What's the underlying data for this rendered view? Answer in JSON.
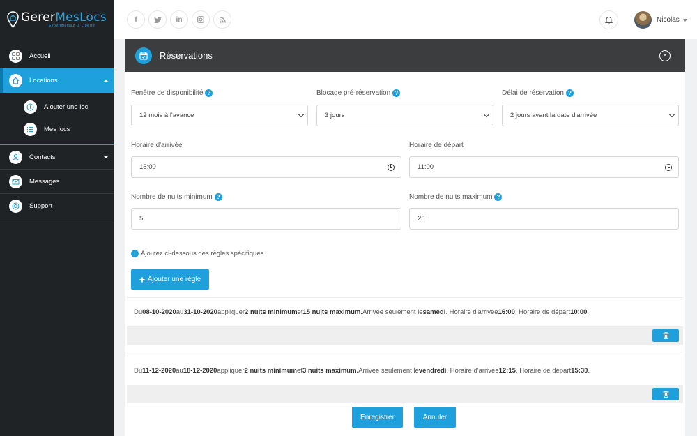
{
  "brand": {
    "name_a": "Gerer",
    "name_b": "MesLocs",
    "tagline": "Expérimentez la Liberté"
  },
  "sidebar": {
    "items": [
      {
        "label": "Accueil"
      },
      {
        "label": "Locations"
      },
      {
        "label": "Contacts"
      },
      {
        "label": "Messages"
      },
      {
        "label": "Support"
      }
    ],
    "sub_items": [
      {
        "label": "Ajouter une loc"
      },
      {
        "label": "Mes locs"
      }
    ]
  },
  "topbar": {
    "social": [
      "f",
      "t",
      "in",
      "ig",
      "rss"
    ],
    "user_name": "Nicolas"
  },
  "panel": {
    "title": "Réservations",
    "availability": {
      "label": "Fenêtre de disponibilité",
      "value": "12 mois à l'avance"
    },
    "block": {
      "label": "Blocage pré-réservation",
      "value": "3 jours"
    },
    "delay": {
      "label": "Délai de réservation",
      "value": "2 jours avant la date d'arrivée"
    },
    "arrival": {
      "label": "Horaire d'arrivée",
      "value": "15:00"
    },
    "departure": {
      "label": "Horaire de départ",
      "value": "11:00"
    },
    "min_nights": {
      "label": "Nombre de nuits minimum",
      "value": "5"
    },
    "max_nights": {
      "label": "Nombre de nuits maximum",
      "value": "25"
    },
    "info_text": "Ajoutez ci-dessous des règles spécifiques.",
    "add_rule_label": "Ajouter une règle",
    "rules": [
      {
        "w1": "Du ",
        "from": "08-10-2020",
        "w2": " au ",
        "to": "31-10-2020",
        "w3": " appliquer ",
        "min": "2 nuits minimum",
        "w4": " et ",
        "max": "15 nuits maximum.",
        "w5": " Arrivée seulement le ",
        "day": "samedi",
        "w6": ". Horaire d'arrivée ",
        "arr": "16:00",
        "w7": ", Horaire de départ ",
        "dep": "10:00",
        "w8": "."
      },
      {
        "w1": "Du ",
        "from": "11-12-2020",
        "w2": " au ",
        "to": "18-12-2020",
        "w3": " appliquer ",
        "min": "2 nuits minimum",
        "w4": " et ",
        "max": "3 nuits maximum.",
        "w5": " Arrivée seulement le ",
        "day": "vendredi",
        "w6": ". Horaire d'arrivée ",
        "arr": "12:15",
        "w7": ", Horaire de départ ",
        "dep": "15:30",
        "w8": "."
      }
    ],
    "save_label": "Enregistrer",
    "cancel_label": "Annuler"
  },
  "colors": {
    "accent": "#1ea0dc",
    "sidebar_bg": "#202326",
    "header_bg": "#3c3d3f"
  }
}
